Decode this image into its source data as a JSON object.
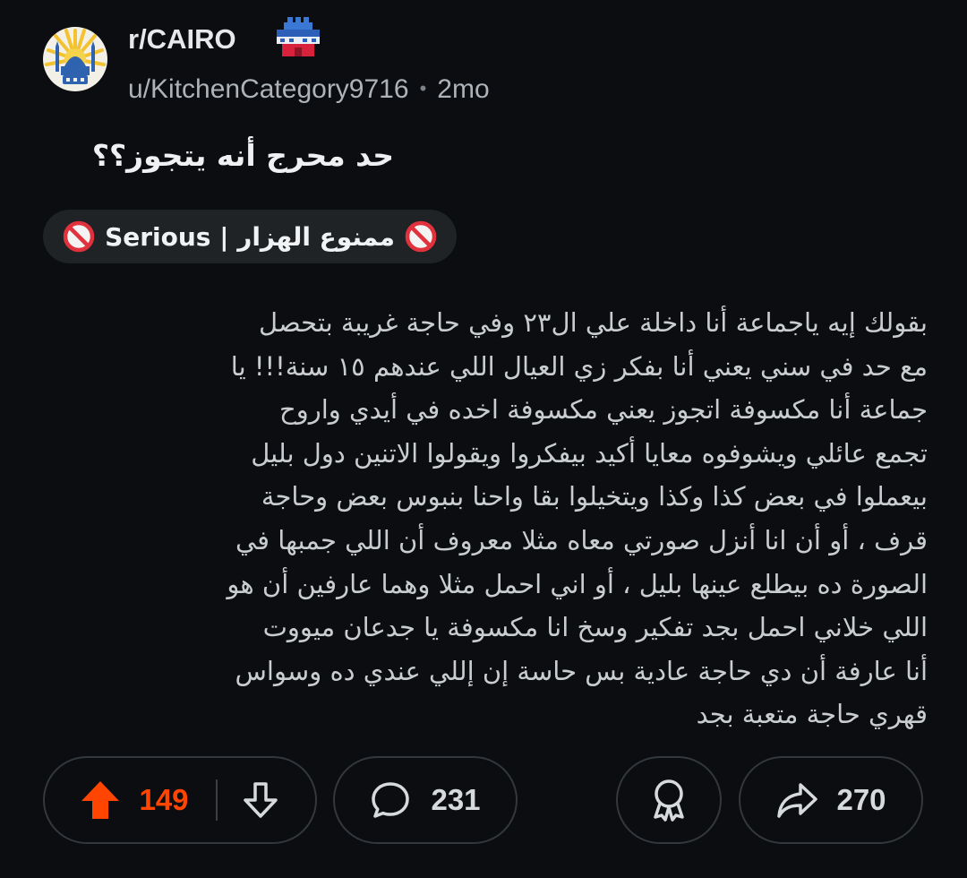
{
  "post": {
    "subreddit": "r/CAIRO",
    "author": "u/KitchenCategory9716",
    "separator": "•",
    "age": "2mo",
    "title": "حد محرج أنه يتجوز؟؟",
    "flair": "Serious | ممنوع الهزار",
    "body_lines": [
      "بقولك إيه ياجماعة أنا داخلة علي ال٢٣ وفي حاجة غريبة بتحصل",
      "مع حد في سني يعني أنا بفكر زي العيال اللي عندهم ١٥ سنة!!! يا",
      "جماعة أنا مكسوفة اتجوز يعني مكسوفة اخده في أيدي واروح",
      "تجمع عائلي ويشوفوه معايا أكيد بيفكروا ويقولوا الاتنين دول بليل",
      "بيعملوا في بعض كذا وكذا ويتخيلوا بقا واحنا بنبوس بعض وحاجة",
      "قرف ، أو أن انا أنزل صورتي معاه مثلا معروف أن اللي جمبها في",
      "الصورة ده بيطلع عينها بليل ، أو اني احمل مثلا وهما عارفين أن هو",
      "اللي خلاني احمل بجد تفكير وسخ انا مكسوفة يا جدعان ميووت",
      "أنا عارفة أن دي حاجة عادية بس حاسة إن إللي عندي ده وسواس",
      "قهري حاجة متعبة بجد"
    ]
  },
  "actions": {
    "score": "149",
    "comments": "231",
    "shares": "270"
  },
  "icons": {
    "subreddit_avatar": "cairo-mosque-logo-icon",
    "flair_badge": "cairo-castle-icon",
    "flair_emoji": "no-entry-icon",
    "upvote": "arrow-up-icon",
    "downvote": "arrow-down-icon",
    "comment": "speech-bubble-icon",
    "award": "award-ribbon-icon",
    "share": "share-arrow-icon"
  },
  "colors": {
    "background": "#0b0d10",
    "upvote_active": "#ff4500",
    "pill_border": "#33383c",
    "flair_bg": "#1f2326",
    "no_entry_red": "#e0313c"
  }
}
